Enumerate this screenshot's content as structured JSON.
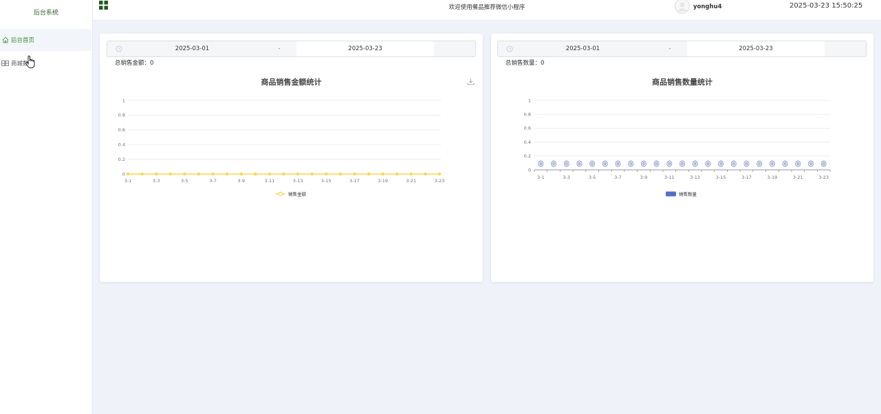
{
  "theme": {
    "accent": "#3d8b37",
    "page_bg": "#eff2f8",
    "menu_icon_color": "#1e5a1e"
  },
  "sidebar": {
    "title": "后台系统",
    "items": [
      {
        "label": "后台首页",
        "icon": "home-icon",
        "active": true
      },
      {
        "label": "商城数",
        "icon": "table-icon",
        "active": false
      }
    ]
  },
  "header": {
    "menu_icon": "grid-menu-icon",
    "welcome": "欢迎使用餐品推荐微信小程序",
    "avatar_icon": "avatar-icon",
    "username": "yonghu4",
    "datetime": "2025-03-23 15:50:25"
  },
  "cards": [
    {
      "date_range": {
        "icon": "clock-icon",
        "start": "2025-03-01",
        "separator": "-",
        "end": "2025-03-23"
      },
      "total_label": "总销售金额：",
      "total_value": "0",
      "toolbox_icon": "download-icon"
    },
    {
      "date_range": {
        "icon": "clock-icon",
        "start": "2025-03-01",
        "separator": "-",
        "end": "2025-03-23"
      },
      "total_label": "总销售数量：",
      "total_value": "0"
    }
  ],
  "chart_data": [
    {
      "type": "line",
      "title": "商品销售金额统计",
      "x_tick_labels": [
        "3-1",
        "3-3",
        "3-5",
        "3-7",
        "3-9",
        "3-11",
        "3-13",
        "3-15",
        "3-17",
        "3-19",
        "3-21",
        "3-23"
      ],
      "yticks": [
        1,
        0.8,
        0.6,
        0.4,
        0.2,
        0
      ],
      "ylim": [
        0,
        1
      ],
      "grid": true,
      "legend": "bottom",
      "series": [
        {
          "name": "销售金额",
          "color": "#f7d64f",
          "values": [
            0,
            0,
            0,
            0,
            0,
            0,
            0,
            0,
            0,
            0,
            0,
            0,
            0,
            0,
            0,
            0,
            0,
            0,
            0,
            0,
            0,
            0,
            0
          ]
        }
      ]
    },
    {
      "type": "bar",
      "title": "商品销售数量统计",
      "x_tick_labels": [
        "3-1",
        "3-3",
        "3-5",
        "3-7",
        "3-9",
        "3-11",
        "3-13",
        "3-15",
        "3-17",
        "3-19",
        "3-21",
        "3-23"
      ],
      "yticks": [
        1,
        0.8,
        0.6,
        0.4,
        0.2,
        0
      ],
      "ylim": [
        0,
        1
      ],
      "grid": true,
      "legend": "bottom",
      "data_labels": true,
      "series": [
        {
          "name": "销售数量",
          "color": "#5470c6",
          "values": [
            0,
            0,
            0,
            0,
            0,
            0,
            0,
            0,
            0,
            0,
            0,
            0,
            0,
            0,
            0,
            0,
            0,
            0,
            0,
            0,
            0,
            0,
            0
          ]
        }
      ]
    }
  ]
}
